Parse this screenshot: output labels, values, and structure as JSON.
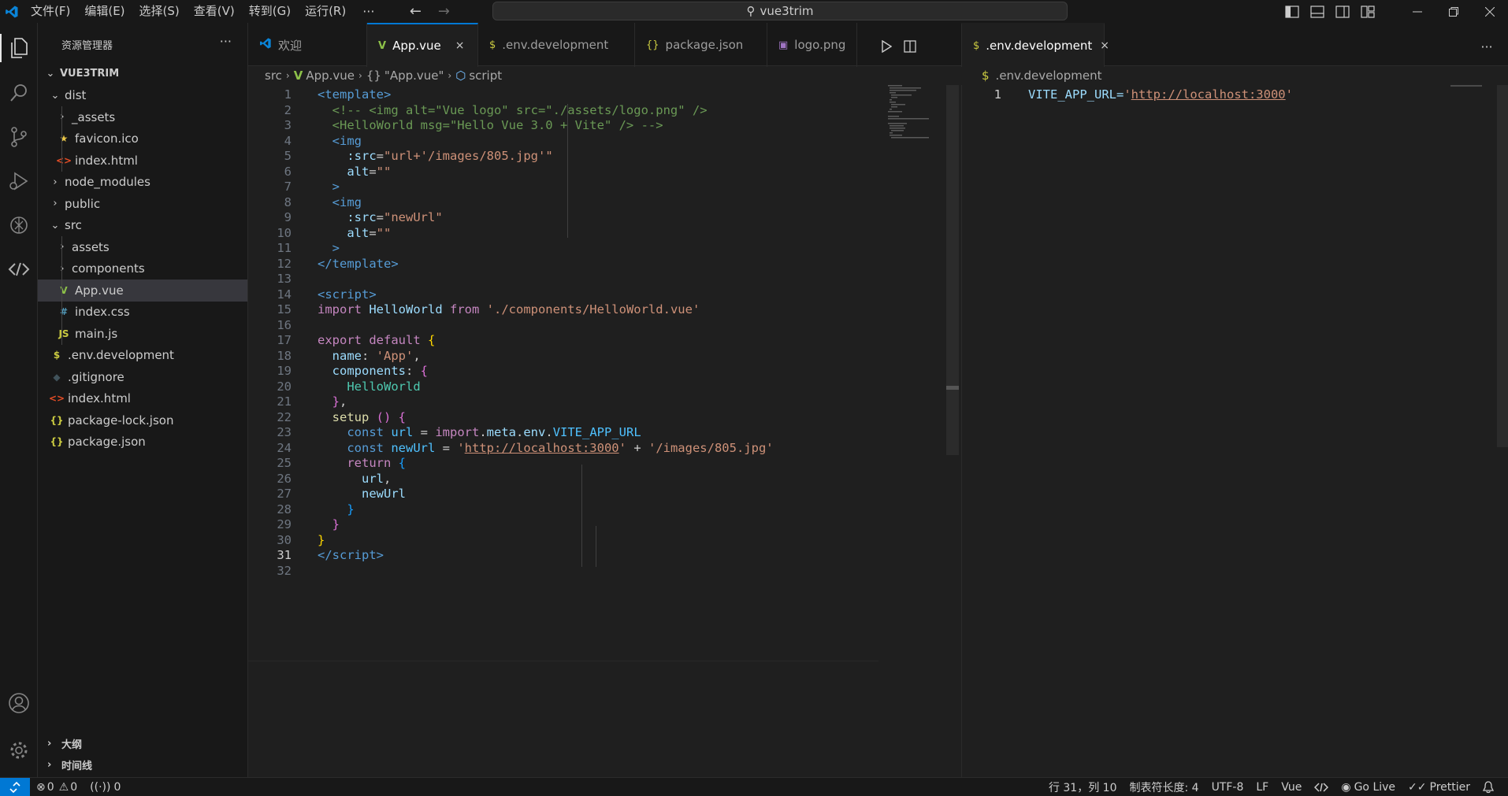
{
  "titlebar": {
    "menus": [
      "文件(F)",
      "编辑(E)",
      "选择(S)",
      "查看(V)",
      "转到(G)",
      "运行(R)"
    ],
    "more": "···",
    "search": "vue3trim"
  },
  "sidebar": {
    "title": "资源管理器",
    "more": "···",
    "root": "VUE3TRIM",
    "items": [
      {
        "label": "dist",
        "chev": "⌄",
        "icon": "",
        "icon_color": "",
        "depth": 1
      },
      {
        "label": "_assets",
        "chev": "›",
        "icon": "",
        "icon_color": "",
        "depth": 2
      },
      {
        "label": "favicon.ico",
        "chev": "",
        "icon": "★",
        "icon_color": "#e8c547",
        "depth": 2
      },
      {
        "label": "index.html",
        "chev": "",
        "icon": "<>",
        "icon_color": "#e44d26",
        "depth": 2
      },
      {
        "label": "node_modules",
        "chev": "›",
        "icon": "",
        "icon_color": "",
        "depth": 1
      },
      {
        "label": "public",
        "chev": "›",
        "icon": "",
        "icon_color": "",
        "depth": 1
      },
      {
        "label": "src",
        "chev": "⌄",
        "icon": "",
        "icon_color": "",
        "depth": 1
      },
      {
        "label": "assets",
        "chev": "›",
        "icon": "",
        "icon_color": "",
        "depth": 2
      },
      {
        "label": "components",
        "chev": "›",
        "icon": "",
        "icon_color": "",
        "depth": 2
      },
      {
        "label": "App.vue",
        "chev": "",
        "icon": "V",
        "icon_color": "#8dc149",
        "depth": 2,
        "selected": true
      },
      {
        "label": "index.css",
        "chev": "",
        "icon": "#",
        "icon_color": "#519aba",
        "depth": 2
      },
      {
        "label": "main.js",
        "chev": "",
        "icon": "JS",
        "icon_color": "#cbcb41",
        "depth": 2
      },
      {
        "label": ".env.development",
        "chev": "",
        "icon": "$",
        "icon_color": "#cbcb41",
        "depth": 1
      },
      {
        "label": ".gitignore",
        "chev": "",
        "icon": "◆",
        "icon_color": "#41535b",
        "depth": 1
      },
      {
        "label": "index.html",
        "chev": "",
        "icon": "<>",
        "icon_color": "#e44d26",
        "depth": 1
      },
      {
        "label": "package-lock.json",
        "chev": "",
        "icon": "{}",
        "icon_color": "#cbcb41",
        "depth": 1
      },
      {
        "label": "package.json",
        "chev": "",
        "icon": "{}",
        "icon_color": "#cbcb41",
        "depth": 1
      }
    ],
    "outline": "大纲",
    "timeline": "时间线"
  },
  "tabs": {
    "welcome": "欢迎",
    "app": "App.vue",
    "env": ".env.development",
    "package": "package.json",
    "logo": "logo.png",
    "env2": ".env.development",
    "close": "×",
    "more": "···"
  },
  "breadcrumb": {
    "src": "src",
    "file": "App.vue",
    "obj": "\"App.vue\"",
    "script": "script",
    "env": ".env.development"
  },
  "editor": {
    "line_numbers": [
      "1",
      "2",
      "3",
      "4",
      "5",
      "6",
      "7",
      "8",
      "9",
      "10",
      "11",
      "12",
      "13",
      "14",
      "15",
      "16",
      "17",
      "18",
      "19",
      "20",
      "21",
      "22",
      "23",
      "24",
      "25",
      "26",
      "27",
      "28",
      "29",
      "30",
      "31",
      "32"
    ],
    "current_line": 31
  },
  "editor2": {
    "line1": "1",
    "key": "VITE_APP_URL=",
    "q1": "'",
    "url": "http://localhost:3000",
    "q2": "'"
  },
  "status": {
    "errors": "0",
    "warnings": "0",
    "ports": "0",
    "position": "行 31，列 10",
    "tab_size": "制表符长度: 4",
    "encoding": "UTF-8",
    "eol": "LF",
    "language": "Vue",
    "golive": "Go Live",
    "prettier": "Prettier"
  },
  "colors": {
    "accent": "#0078d4",
    "background": "#1f1f1f",
    "sidebar": "#181818"
  }
}
